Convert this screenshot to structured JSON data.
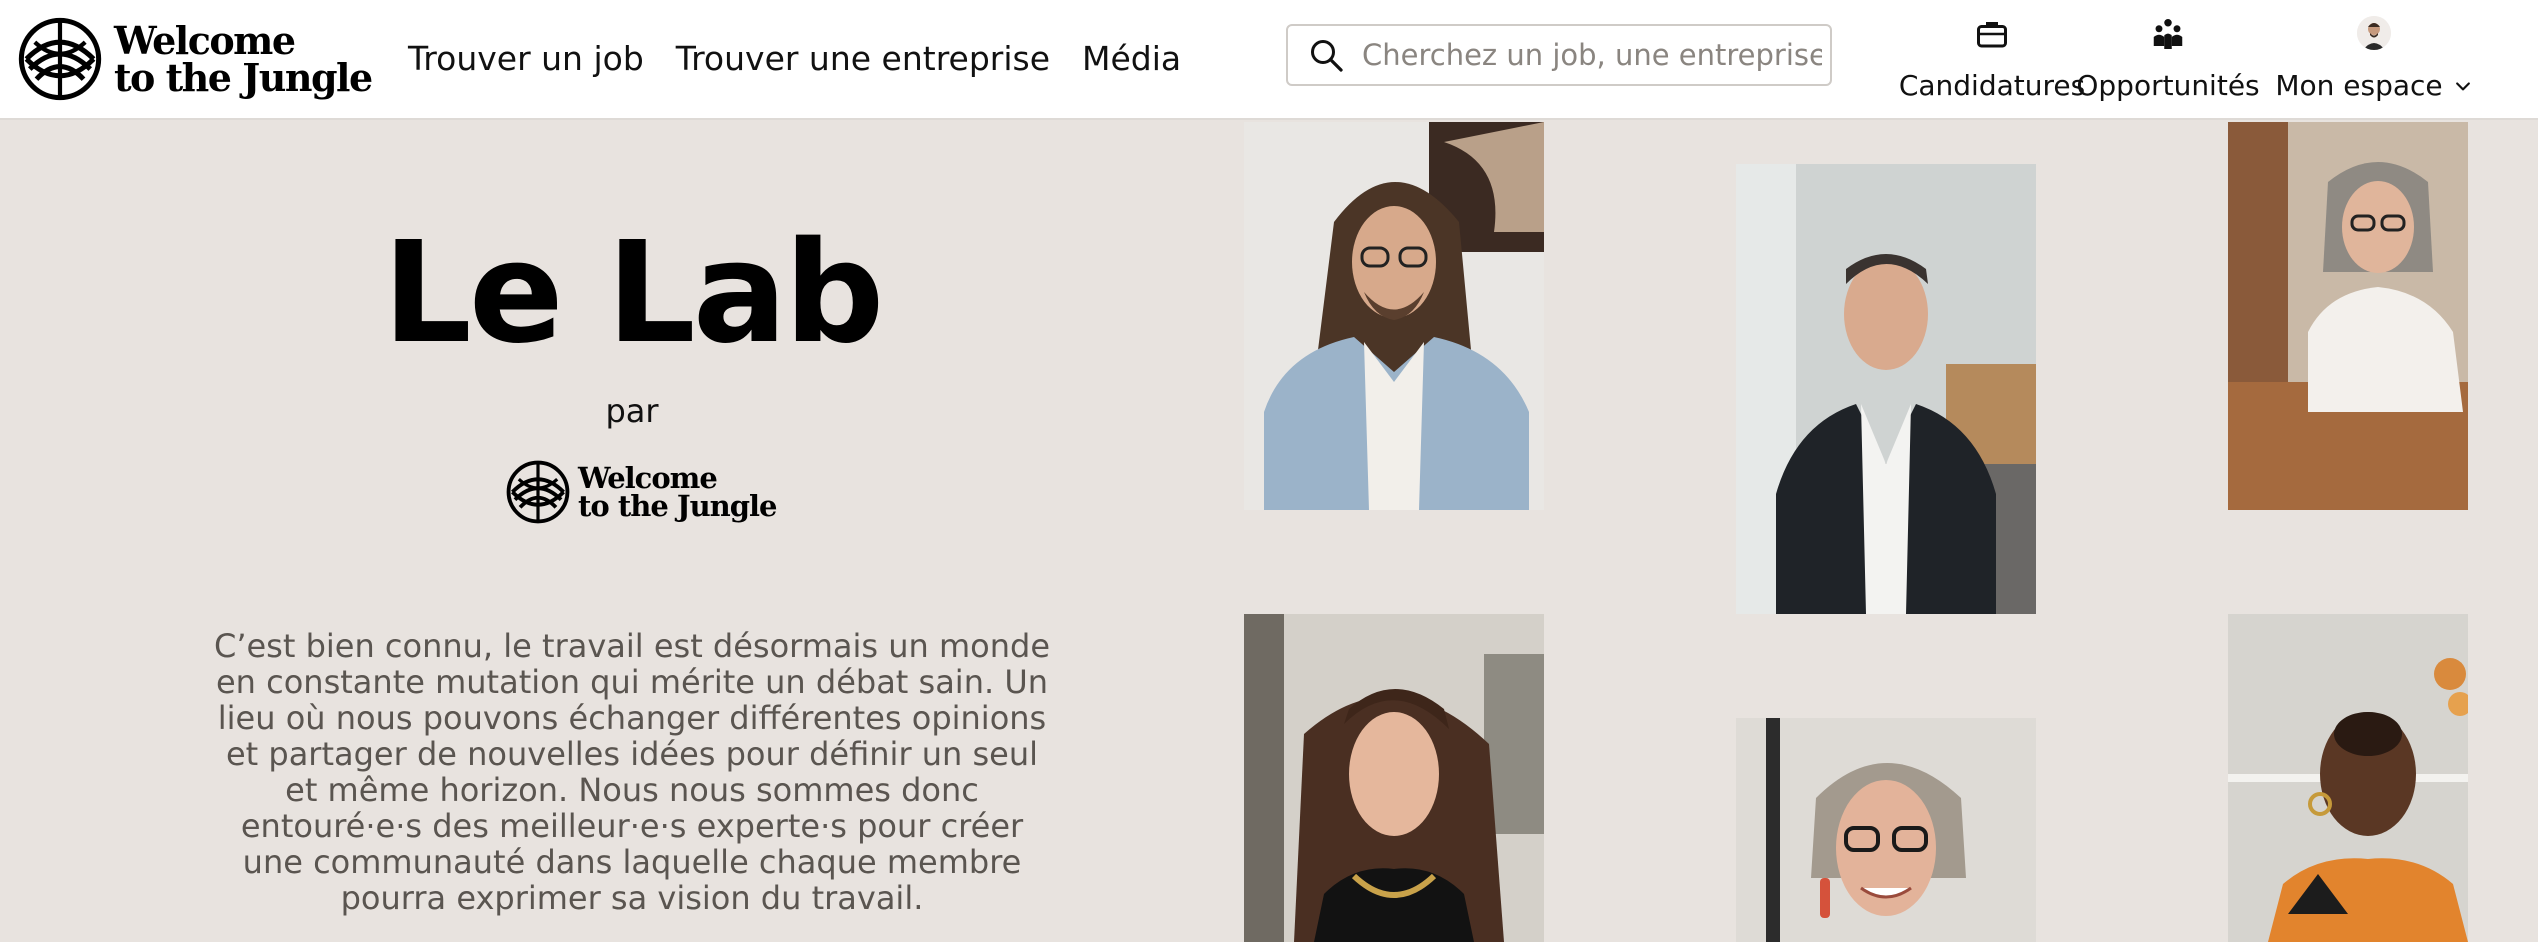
{
  "header": {
    "logo_line1": "Welcome",
    "logo_line2": "to the Jungle",
    "nav": [
      "Trouver un job",
      "Trouver une entreprise",
      "Média"
    ],
    "search_placeholder": "Cherchez un job, une entreprise...",
    "candidatures_label": "Candidatures",
    "opportunites_label": "Opportunités",
    "mon_espace_label": "Mon espace"
  },
  "hero": {
    "title": "Le Lab",
    "par": "par",
    "logo_line1": "Welcome",
    "logo_line2": "to the Jungle",
    "intro": "C’est bien connu, le travail est désormais un monde en constante mutation qui mérite un débat sain. Un lieu où nous pouvons échanger différentes opinions et partager de nouvelles idées pour définir un seul et même horizon. Nous nous sommes donc entouré·e·s des meilleur·e·s experte·s pour créer une communauté dans laquelle chaque membre pourra exprimer sa vision du travail."
  },
  "icons": {
    "logo": "jungle-logo-icon",
    "search": "search-icon",
    "candidatures": "briefcase-icon",
    "opportunites": "people-icon",
    "mon_espace": "user-avatar-icon",
    "dropdown": "chevron-down-icon"
  },
  "colors": {
    "background": "#e8e3df",
    "header_bg": "#ffffff",
    "text": "#111111",
    "intro_text": "#5a5550"
  }
}
